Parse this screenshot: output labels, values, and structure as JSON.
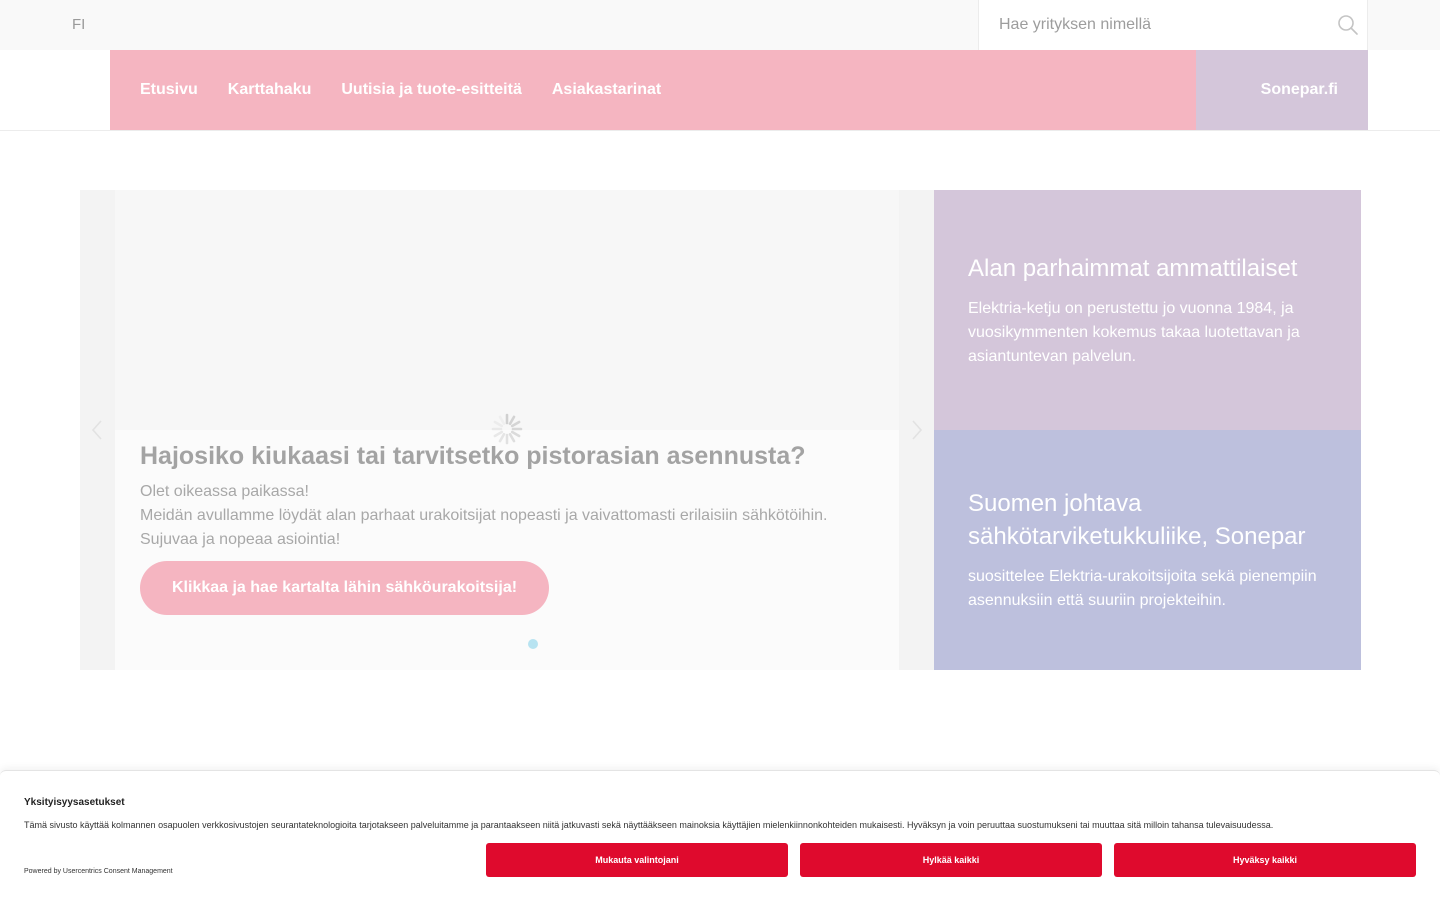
{
  "topbar": {
    "language": "FI",
    "search": {
      "placeholder": "Hae yrityksen nimellä"
    }
  },
  "nav": {
    "items": [
      {
        "label": "Etusivu"
      },
      {
        "label": "Karttahaku"
      },
      {
        "label": "Uutisia ja tuote-esitteitä"
      },
      {
        "label": "Asiakastarinat"
      }
    ],
    "external_link": "Sonepar.fi"
  },
  "slider": {
    "title": "Hajosiko kiukaasi tai tarvitsetko pistorasian asennusta?",
    "text_line1": "Olet oikeassa paikassa!",
    "text_line2": "Meidän avullamme löydät alan parhaat urakoitsijat nopeasti ja vaivattomasti erilaisiin sähkötöihin. Sujuvaa ja nopeaa asiointia!",
    "button": "Klikkaa ja hae kartalta lähin sähköurakoitsija!",
    "icons": {
      "prev": "chevron-left-icon",
      "next": "chevron-right-icon",
      "loading": "spinner-icon"
    }
  },
  "panels": [
    {
      "title": "Alan parhaimmat ammattilaiset",
      "text": "Elektria-ketju on perustettu jo vuonna 1984, ja vuosikymmenten kokemus takaa luotettavan ja asiantuntevan palvelun."
    },
    {
      "title": "Suomen johtava sähkötarviketukkuliike, Sonepar",
      "text": "suosittelee Elektria-urakoitsijoita sekä pienempiin asennuksiin että suuriin projekteihin."
    }
  ],
  "consent": {
    "title": "Yksityisyysasetukset",
    "text": "Tämä sivusto käyttää kolmannen osapuolen verkkosivustojen seurantateknologioita tarjotakseen palveluitamme ja parantaakseen niitä jatkuvasti sekä näyttääkseen mainoksia käyttäjien mielenkiinnonkohteiden mukaisesti. Hyväksyn ja voin peruuttaa suostumukseni tai muuttaa sitä milloin tahansa tulevaisuudessa.",
    "powered_by": "Powered by Usercentrics Consent Management",
    "buttons": {
      "customize": "Mukauta valintojani",
      "reject": "Hylkää kaikki",
      "accept": "Hyväksy kaikki"
    }
  },
  "colors": {
    "nav_pink": "#f5b5c1",
    "lilac": "#d4c6da",
    "periwinkle": "#bdc0dd",
    "consent_red": "#df0a2d",
    "slider_dot": "#b7e3f1"
  }
}
